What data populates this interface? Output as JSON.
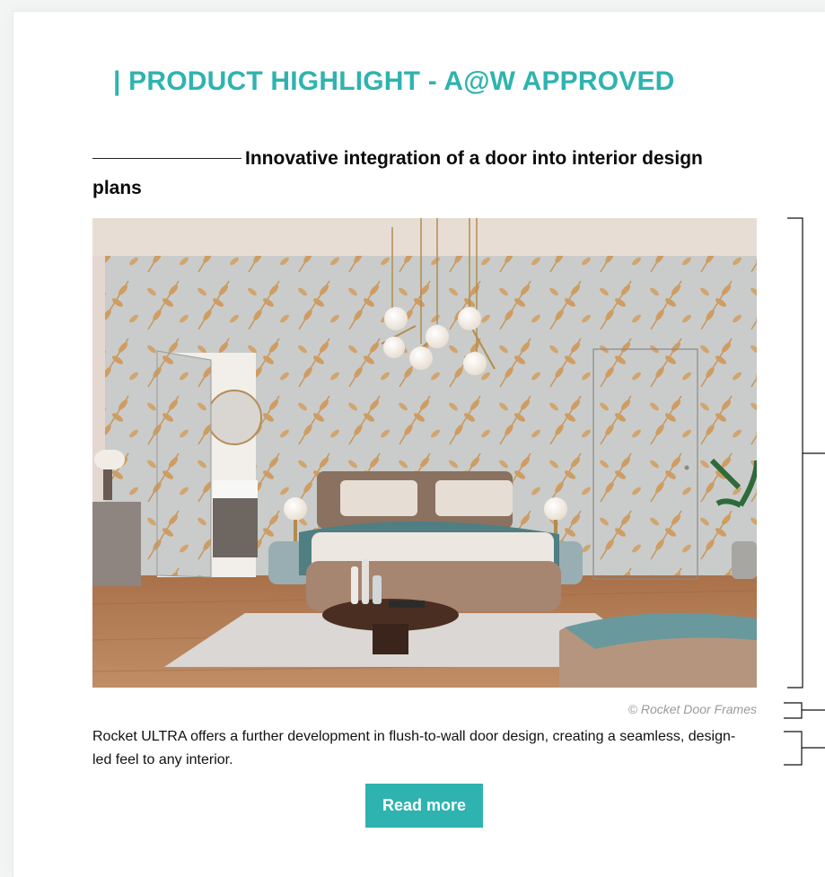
{
  "product": {
    "heading": "| PRODUCT HIGHLIGHT - A@W APPROVED",
    "subtitle": "Innovative integration of a door into interior design plans",
    "image_alt": "Bedroom with leaf-patterned wallpaper, flush-to-wall doors, upholstered bed and pendant globe lights",
    "credit": "© Rocket Door Frames",
    "description": "Rocket ULTRA offers a further development in flush-to-wall door design, creating a seamless, design-led feel to any interior.",
    "cta_label": "Read more"
  },
  "colors": {
    "accent": "#2fb3b0",
    "text": "#111111",
    "credit": "#9a9a9a",
    "background": "#ffffff"
  }
}
